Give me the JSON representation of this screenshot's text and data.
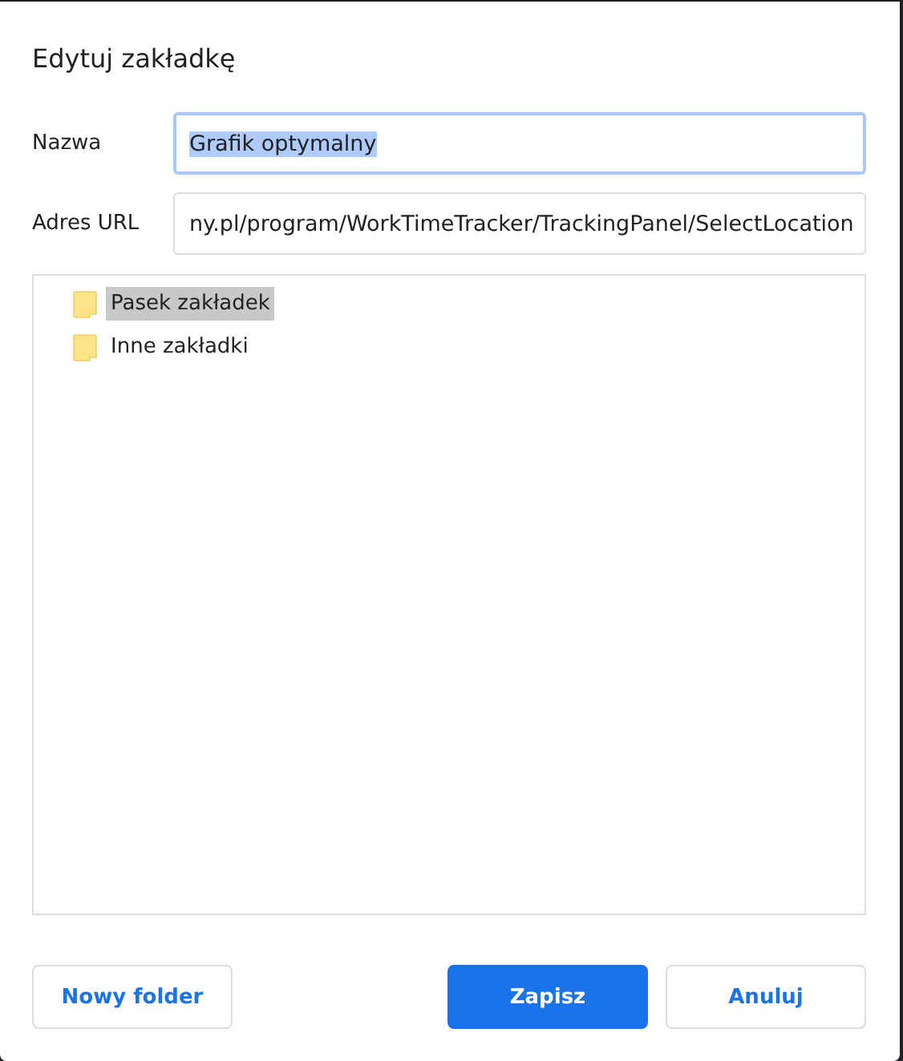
{
  "dialog": {
    "title": "Edytuj zakładkę"
  },
  "fields": [
    {
      "label": "Nazwa",
      "value": "Grafik optymalny",
      "focused": true,
      "value_selected": true
    },
    {
      "label": "Adres URL",
      "value": "ny.pl/program/WorkTimeTracker/TrackingPanel/SelectLocation",
      "focused": false,
      "value_selected": false
    }
  ],
  "folders": [
    {
      "name": "Pasek zakładek",
      "selected": true
    },
    {
      "name": "Inne zakładki",
      "selected": false
    }
  ],
  "buttons": [
    {
      "label": "Nowy folder",
      "kind": "secondary"
    },
    {
      "label": "Zapisz",
      "kind": "primary"
    },
    {
      "label": "Anuluj",
      "kind": "secondary"
    }
  ]
}
